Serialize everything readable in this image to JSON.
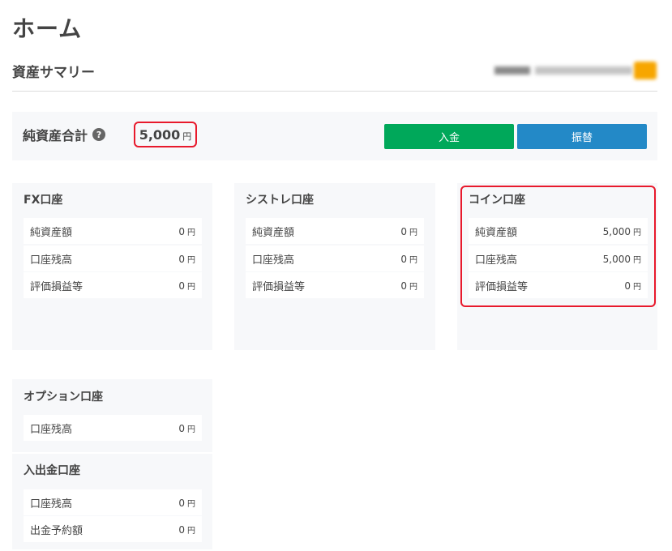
{
  "page_title": "ホーム",
  "section_title": "資産サマリー",
  "total": {
    "label": "純資産合計",
    "help_icon": "question-circle-icon",
    "value": "5,000",
    "unit": "円"
  },
  "buttons": {
    "deposit": "入金",
    "transfer": "振替"
  },
  "colors": {
    "deposit_button": "#00a85a",
    "transfer_button": "#2389c7",
    "highlight": "#e8192c"
  },
  "accounts": {
    "fx": {
      "title": "FX口座",
      "rows": [
        {
          "label": "純資産額",
          "value": "0",
          "unit": "円"
        },
        {
          "label": "口座残高",
          "value": "0",
          "unit": "円"
        },
        {
          "label": "評価損益等",
          "value": "0",
          "unit": "円"
        }
      ]
    },
    "systre": {
      "title": "シストレ口座",
      "rows": [
        {
          "label": "純資産額",
          "value": "0",
          "unit": "円"
        },
        {
          "label": "口座残高",
          "value": "0",
          "unit": "円"
        },
        {
          "label": "評価損益等",
          "value": "0",
          "unit": "円"
        }
      ]
    },
    "coin": {
      "title": "コイン口座",
      "rows": [
        {
          "label": "純資産額",
          "value": "5,000",
          "unit": "円"
        },
        {
          "label": "口座残高",
          "value": "5,000",
          "unit": "円"
        },
        {
          "label": "評価損益等",
          "value": "0",
          "unit": "円"
        }
      ]
    },
    "option": {
      "title": "オプション口座",
      "rows": [
        {
          "label": "口座残高",
          "value": "0",
          "unit": "円"
        }
      ]
    },
    "deposit_withdraw": {
      "title": "入出金口座",
      "rows": [
        {
          "label": "口座残高",
          "value": "0",
          "unit": "円"
        },
        {
          "label": "出金予約額",
          "value": "0",
          "unit": "円"
        }
      ]
    }
  }
}
